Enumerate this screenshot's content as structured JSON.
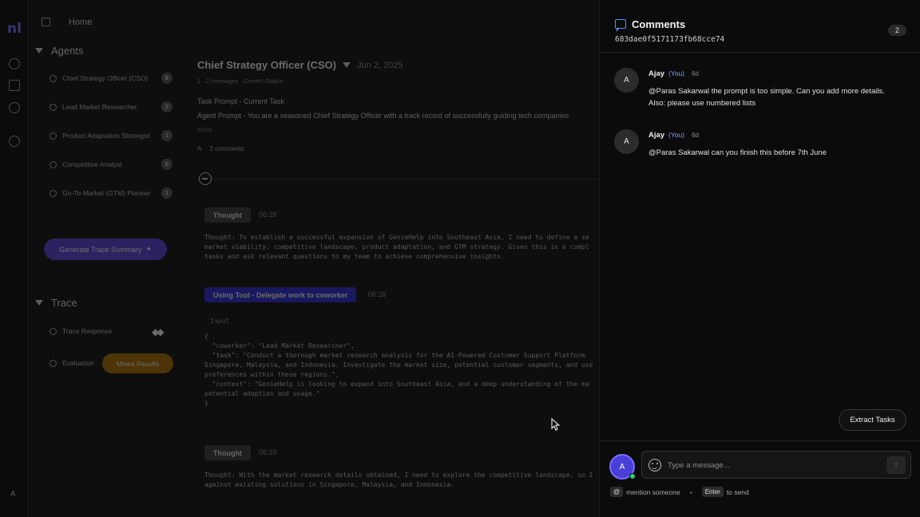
{
  "app": {
    "logo": "nl",
    "user_initial": "A"
  },
  "topbar": {
    "home_label": "Home"
  },
  "agents": {
    "heading": "Agents",
    "items": [
      {
        "label": "Chief Strategy Officer (CSO)",
        "badge": "8"
      },
      {
        "label": "Lead Market Researcher",
        "badge": "2"
      },
      {
        "label": "Product Adaptation Strategist",
        "badge": "1"
      },
      {
        "label": "Competitive Analyst",
        "badge": "0"
      },
      {
        "label": "Go-To-Market (GTM) Planner",
        "badge": "1"
      }
    ]
  },
  "generate_button": "Generate Trace Summary",
  "trace": {
    "heading": "Trace",
    "response_label": "Trace Response",
    "evaluation_label": "Evaluation",
    "mixed_label": "Mixed Results"
  },
  "main": {
    "agent_title": "Chief Strategy Officer (CSO)",
    "date": "Jun 2, 2025",
    "meta": "1 · 2 messages · Correct Output",
    "task_prompt": "Task Prompt - Current Task",
    "agent_prompt": "Agent Prompt - You are a seasoned Chief Strategy Officer with a track record of successfully guiding tech companies",
    "more": "more",
    "comment_avatar": "A",
    "comments_count_label": "2 comments",
    "steps": [
      {
        "tag": "Thought",
        "time": "06:28",
        "text": "Thought: To establish a successful expansion of GenieHelp into Southeast Asia, I need to define a se\nmarket viability, competitive landscape, product adaptation, and GTM strategy. Given this is a compl\ntasks and ask relevant questions to my team to achieve comprehensive insights."
      },
      {
        "tag": "Using Tool - Delegate work to coworker",
        "time": "06:28",
        "input_label": "Input",
        "text": "{\n  \"coworker\": \"Lead Market Researcher\",\n  \"task\": \"Conduct a thorough market research analysis for the AI-Powered Customer Support Platform\nSingapore, Malaysia, and Indonesia. Investigate the market size, potential customer segments, and use\npreferences within these regions.\",\n  \"context\": \"GenieHelp is looking to expand into Southeast Asia, and a deep understanding of the ma\npotential adoption and usage.\"\n}"
      },
      {
        "tag": "Thought",
        "time": "06:28",
        "text": "Thought: With the market research details obtained, I need to explore the competitive landscape, so I\nagainst existing solutions in Singapore, Malaysia, and Indonesia."
      }
    ]
  },
  "comments_panel": {
    "title": "Comments",
    "trace_id": "683dae0f5171173fb68cce74",
    "count": "2",
    "items": [
      {
        "avatar": "A",
        "name": "Ajay",
        "you": "(You)",
        "ago": "6d",
        "line1": "@Paras Sakarwal the prompt is too simple. Can you add more details.",
        "line2": "Also: please use numbered lists"
      },
      {
        "avatar": "A",
        "name": "Ajay",
        "you": "(You)",
        "ago": "6d",
        "line1": "@Paras Sakarwal can you finish this before 7th June",
        "line2": ""
      }
    ],
    "extract_button": "Extract Tasks",
    "composer": {
      "avatar": "A",
      "placeholder": "Type a message...",
      "send_icon": "↑",
      "hint_at_key": "@",
      "hint_mention": "mention someone",
      "hint_dot": "•",
      "hint_enter_key": "Enter",
      "hint_send": "to send"
    }
  },
  "colors": {
    "accent": "#5b8cff",
    "tool_tag": "#2b2bd0",
    "mixed": "#a36a00",
    "generate": "#5a3fd6"
  }
}
